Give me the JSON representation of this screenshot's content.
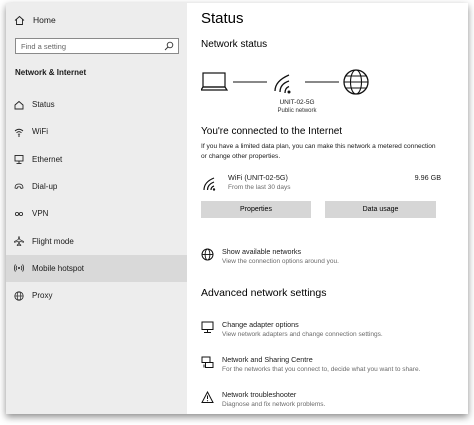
{
  "sidebar": {
    "home_label": "Home",
    "search_placeholder": "Find a setting",
    "section_title": "Network & Internet",
    "items": [
      {
        "label": "Status",
        "icon": "home-status-icon",
        "selected": false
      },
      {
        "label": "WiFi",
        "icon": "wifi-icon",
        "selected": false
      },
      {
        "label": "Ethernet",
        "icon": "ethernet-icon",
        "selected": false
      },
      {
        "label": "Dial-up",
        "icon": "dialup-icon",
        "selected": false
      },
      {
        "label": "VPN",
        "icon": "vpn-icon",
        "selected": false
      },
      {
        "label": "Flight mode",
        "icon": "airplane-icon",
        "selected": false
      },
      {
        "label": "Mobile hotspot",
        "icon": "hotspot-icon",
        "selected": true
      },
      {
        "label": "Proxy",
        "icon": "globe-icon",
        "selected": false
      }
    ]
  },
  "main": {
    "title": "Status",
    "network_status_title": "Network status",
    "network": {
      "name": "UNIT-02-5G",
      "type": "Public network"
    },
    "connected_title": "You're connected to the Internet",
    "connected_desc": "If you have a limited data plan, you can make this network a metered connection or change other properties.",
    "wifi": {
      "name": "WiFi (UNIT-02-5G)",
      "sub": "From the last 30 days",
      "usage": "9.96 GB"
    },
    "buttons": {
      "properties": "Properties",
      "data_usage": "Data usage"
    },
    "show_networks": {
      "title": "Show available networks",
      "desc": "View the connection options around you."
    },
    "advanced_title": "Advanced network settings",
    "advanced_items": [
      {
        "title": "Change adapter options",
        "desc": "View network adapters and change connection settings."
      },
      {
        "title": "Network and Sharing Centre",
        "desc": "For the networks that you connect to, decide what you want to share."
      },
      {
        "title": "Network troubleshooter",
        "desc": "Diagnose and fix network problems."
      }
    ]
  }
}
